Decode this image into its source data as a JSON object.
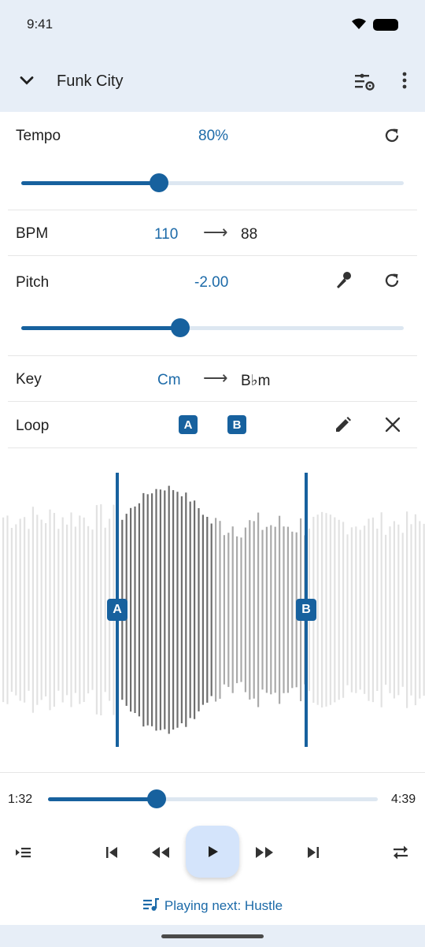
{
  "status_bar": {
    "time": "9:41"
  },
  "app_bar": {
    "title": "Funk City"
  },
  "tempo": {
    "label": "Tempo",
    "value": "80%",
    "slider_fraction": 0.36
  },
  "bpm": {
    "label": "BPM",
    "from": "110",
    "arrow": "⟶",
    "to": "88"
  },
  "pitch": {
    "label": "Pitch",
    "value": "-2.00",
    "slider_fraction": 0.415
  },
  "key": {
    "label": "Key",
    "from": "Cm",
    "arrow": "⟶",
    "to": "B♭m"
  },
  "loop": {
    "label": "Loop",
    "a_label": "A",
    "b_label": "B"
  },
  "waveform": {
    "marker_a": "A",
    "marker_b": "B"
  },
  "timeline": {
    "current": "1:32",
    "total": "4:39",
    "progress_fraction": 0.33
  },
  "playing_next": {
    "text": "Playing next: Hustle"
  },
  "colors": {
    "accent": "#17619e",
    "accent_text": "#1c6aa8",
    "header_bg": "#e7eef7",
    "play_bg": "#d4e4fb"
  }
}
